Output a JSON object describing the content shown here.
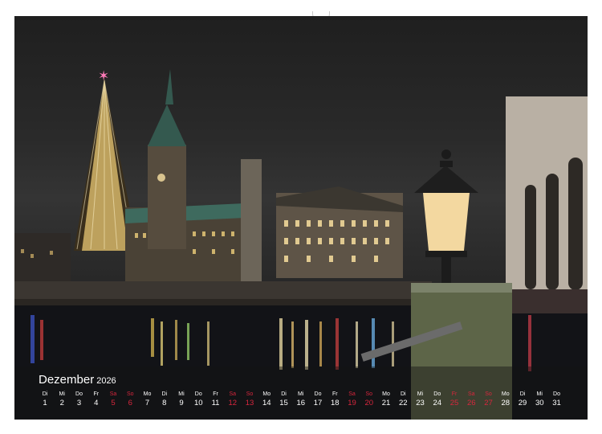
{
  "calendar": {
    "month": "Dezember",
    "year": "2026",
    "accent_color": "#d7263d",
    "days": [
      {
        "dn": "Di",
        "dd": "1",
        "we": false
      },
      {
        "dn": "Mi",
        "dd": "2",
        "we": false
      },
      {
        "dn": "Do",
        "dd": "3",
        "we": false
      },
      {
        "dn": "Fr",
        "dd": "4",
        "we": false
      },
      {
        "dn": "Sa",
        "dd": "5",
        "we": true
      },
      {
        "dn": "So",
        "dd": "6",
        "we": true
      },
      {
        "dn": "Mo",
        "dd": "7",
        "we": false
      },
      {
        "dn": "Di",
        "dd": "8",
        "we": false
      },
      {
        "dn": "Mi",
        "dd": "9",
        "we": false
      },
      {
        "dn": "Do",
        "dd": "10",
        "we": false
      },
      {
        "dn": "Fr",
        "dd": "11",
        "we": false
      },
      {
        "dn": "Sa",
        "dd": "12",
        "we": true
      },
      {
        "dn": "So",
        "dd": "13",
        "we": true
      },
      {
        "dn": "Mo",
        "dd": "14",
        "we": false
      },
      {
        "dn": "Di",
        "dd": "15",
        "we": false
      },
      {
        "dn": "Mi",
        "dd": "16",
        "we": false
      },
      {
        "dn": "Do",
        "dd": "17",
        "we": false
      },
      {
        "dn": "Fr",
        "dd": "18",
        "we": false
      },
      {
        "dn": "Sa",
        "dd": "19",
        "we": true
      },
      {
        "dn": "So",
        "dd": "20",
        "we": true
      },
      {
        "dn": "Mo",
        "dd": "21",
        "we": false
      },
      {
        "dn": "Di",
        "dd": "22",
        "we": false
      },
      {
        "dn": "Mi",
        "dd": "23",
        "we": false
      },
      {
        "dn": "Do",
        "dd": "24",
        "we": false
      },
      {
        "dn": "Fr",
        "dd": "25",
        "we": true
      },
      {
        "dn": "Sa",
        "dd": "26",
        "we": true
      },
      {
        "dn": "So",
        "dd": "27",
        "we": true
      },
      {
        "dn": "Mo",
        "dd": "28",
        "we": false
      },
      {
        "dn": "Di",
        "dd": "29",
        "we": false
      },
      {
        "dn": "Mi",
        "dd": "30",
        "we": false
      },
      {
        "dn": "Do",
        "dd": "31",
        "we": false
      }
    ]
  },
  "photo": {
    "subject": "night-city-christmas-scene",
    "icons": [
      "star-icon",
      "street-lamp-icon"
    ]
  }
}
